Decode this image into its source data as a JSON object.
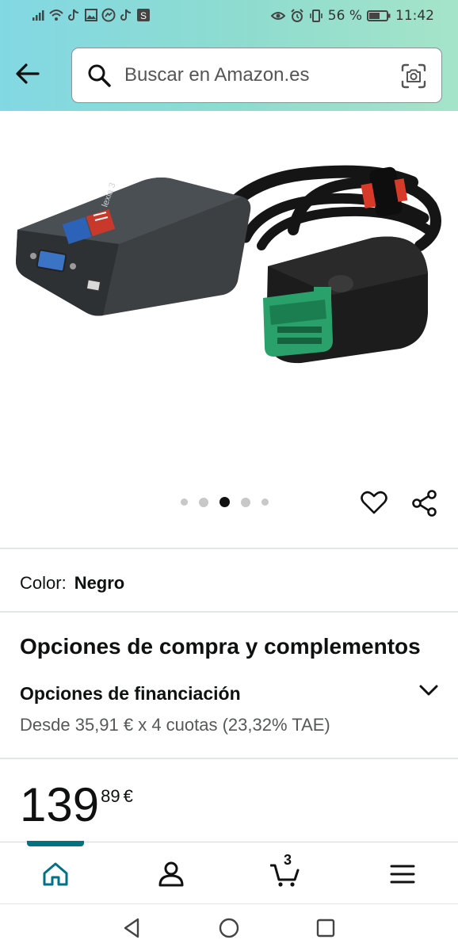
{
  "status_bar": {
    "battery_percent": "56 %",
    "time": "11:42",
    "icons_left": [
      "signal-icon",
      "wifi-icon",
      "tiktok-icon",
      "gallery-icon",
      "messenger-icon",
      "tiktok-icon",
      "s-app-icon"
    ],
    "icons_right": [
      "eye-icon",
      "alarm-icon",
      "vibrate-icon",
      "battery-icon"
    ]
  },
  "header": {
    "search_placeholder": "Buscar en Amazon.es"
  },
  "carousel": {
    "dot_count": 5,
    "active_index": 2
  },
  "product": {
    "color_label": "Color:",
    "color_value": "Negro",
    "purchase_options_title": "Opciones de compra y complementos",
    "financing_title": "Opciones de financiación",
    "financing_detail": "Desde 35,91 € x 4 cuotas (23,32% TAE)",
    "price_whole": "139",
    "price_fraction": "89",
    "price_currency": "€"
  },
  "bottom_nav": {
    "items": [
      "home",
      "account",
      "cart",
      "menu"
    ],
    "active": "home",
    "cart_count": "3"
  },
  "colors": {
    "header_gradient_start": "#82d8e3",
    "header_gradient_end": "#a5e4c9",
    "nav_active": "#007185",
    "connector_green": "#1f8f5a"
  }
}
